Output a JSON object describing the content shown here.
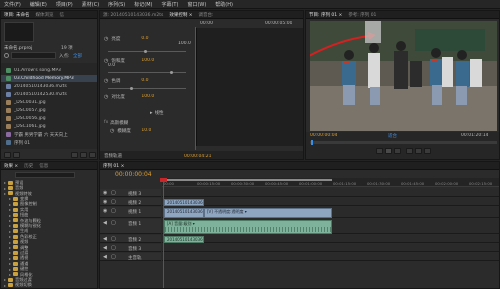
{
  "menu": [
    "文件(F)",
    "编辑(E)",
    "项目(P)",
    "素材(C)",
    "序列(S)",
    "标记(M)",
    "字幕(T)",
    "窗口(W)",
    "帮助(H)"
  ],
  "project": {
    "tabs": [
      "项目: 未命名",
      "媒体浏览",
      "信"
    ],
    "file_name": "未命名.prproj",
    "count": "19 项",
    "in_label": "入点:",
    "all_label": "全部",
    "items": [
      "01.Arrow's song.MP3",
      "03.Childhood Memory.MP3",
      "20140510143036.m2ts",
      "20140510142530.m2ts",
      "_DSC0031.jpg",
      "_DSC0057.jpg",
      "_DSC0056.jpg",
      "_DSC1061.jpg",
      "学霸 男男学霸 六 天天向上",
      "序列 01"
    ]
  },
  "effects": {
    "tabs": [
      "源: 20140510143036.m2ts",
      "效果控制 ×",
      "调音台:"
    ],
    "timecode_start": "00:00",
    "timecode_end": "00:00:05:00",
    "params": [
      {
        "name": "亮度",
        "value": "0.0"
      },
      {
        "name": "饱和度",
        "value": "100.0"
      },
      {
        "name": "色调",
        "value": "0.0"
      },
      {
        "name": "对比度",
        "value": "100.0"
      }
    ],
    "scale_max": "100.0",
    "scale_min": "0.0",
    "link_label": "线性",
    "group_label": "高斯模糊",
    "blur_label": "模糊度",
    "blur_value": "10.0",
    "footer": "音频轨道",
    "footer_time": "00:00:04:21"
  },
  "program": {
    "tabs": [
      "节目: 序列 01 ×",
      "参考: 序列 01"
    ],
    "timecode": "00:00:00:04",
    "fit": "适合",
    "duration": "00:01:20:14"
  },
  "sequence_bar": {
    "tab": "序列 01 ×",
    "timecode": "00:00:00:04",
    "rulers": [
      "00:00",
      "00:00:15:00",
      "00:00:30:00",
      "00:00:45:00",
      "00:01:00:00",
      "00:01:15:00",
      "00:01:30:00",
      "00:01:45:00",
      "00:02:00:00",
      "00:02:15:00"
    ]
  },
  "effects_panel": {
    "tabs": [
      "效果 ×",
      "历史",
      "信息"
    ],
    "tree": [
      {
        "label": "预设",
        "indent": 0
      },
      {
        "label": "音频",
        "indent": 0
      },
      {
        "label": "视频特效",
        "indent": 0
      },
      {
        "label": "变换",
        "indent": 1
      },
      {
        "label": "图像控制",
        "indent": 1
      },
      {
        "label": "实用",
        "indent": 1
      },
      {
        "label": "扭曲",
        "indent": 1
      },
      {
        "label": "杂波与颗粒",
        "indent": 1
      },
      {
        "label": "模糊与锐化",
        "indent": 1
      },
      {
        "label": "生成",
        "indent": 1
      },
      {
        "label": "色彩校正",
        "indent": 1
      },
      {
        "label": "视频",
        "indent": 1
      },
      {
        "label": "调整",
        "indent": 1
      },
      {
        "label": "过渡",
        "indent": 1
      },
      {
        "label": "透视",
        "indent": 1
      },
      {
        "label": "通道",
        "indent": 1
      },
      {
        "label": "键控",
        "indent": 1
      },
      {
        "label": "风格化",
        "indent": 1
      },
      {
        "label": "音频过渡",
        "indent": 0
      },
      {
        "label": "视频切换",
        "indent": 0
      }
    ]
  },
  "timeline": {
    "tracks": [
      {
        "name": "视频 3",
        "type": "video"
      },
      {
        "name": "视频 2",
        "type": "video"
      },
      {
        "name": "视频 1",
        "type": "video"
      },
      {
        "name": "音频 1",
        "type": "audio"
      },
      {
        "name": "音频 2",
        "type": "audio"
      },
      {
        "name": "音频 3",
        "type": "audio"
      },
      {
        "name": "主音轨",
        "type": "master"
      }
    ],
    "clips": {
      "v2": "20140510143036.m2ts",
      "v1a": "20140510143036.m2ts",
      "v1b": "[V] 不透明度:透明度 ▾",
      "a1": "[A] 音量:级别 ▾",
      "a2": "20140510143036.m2ts"
    }
  },
  "colors": {
    "accent_blue": "#3d8ee3",
    "timecode_orange": "#e0a030",
    "playhead_red": "#c8262b",
    "video_clip": "#8fa6c0",
    "audio_clip": "#7fb29a"
  }
}
